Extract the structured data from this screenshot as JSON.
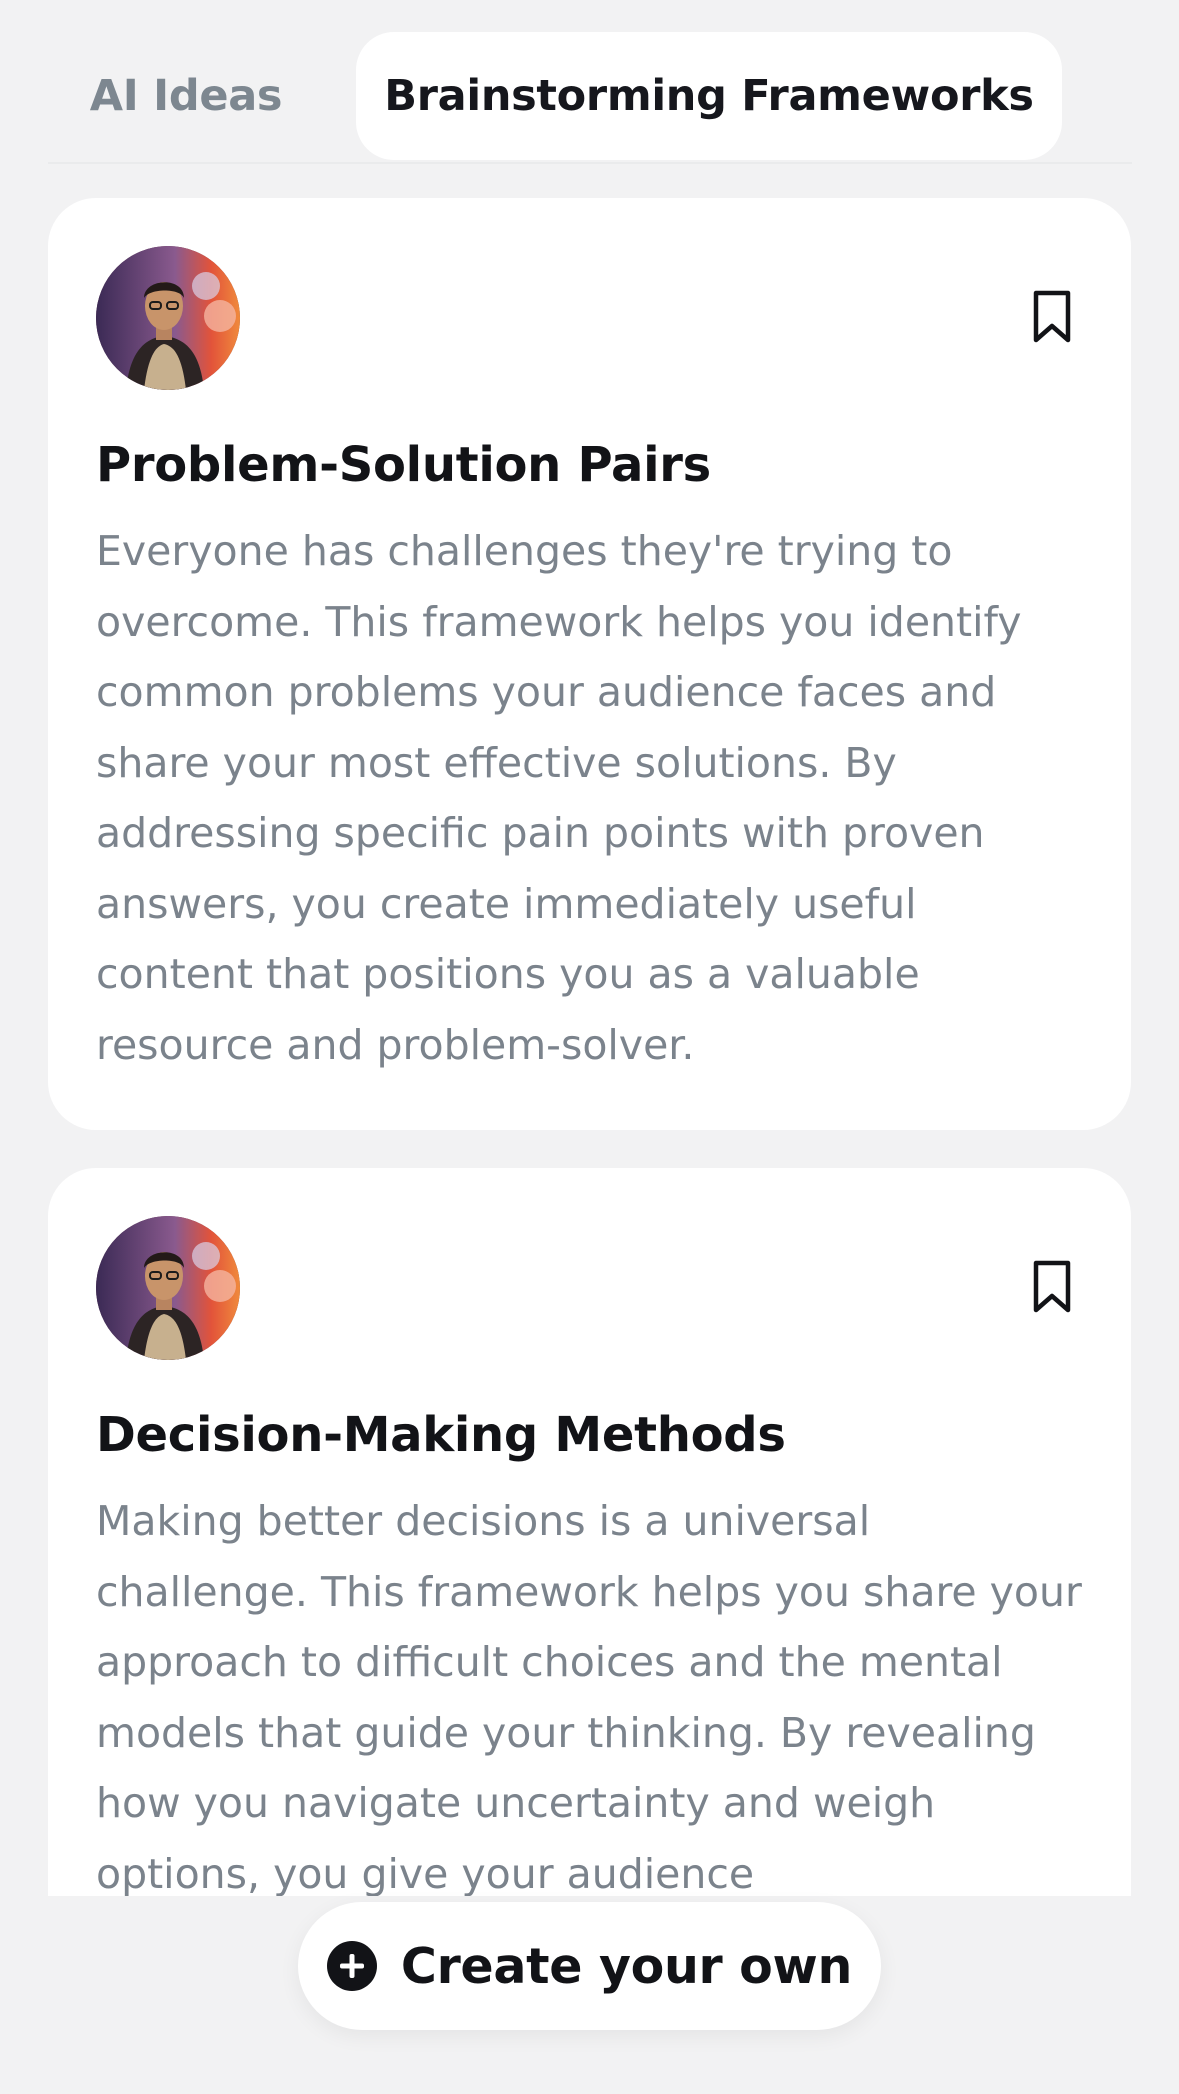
{
  "tabs": [
    {
      "label": "AI Ideas",
      "active": false
    },
    {
      "label": "Brainstorming Frameworks",
      "active": true
    }
  ],
  "cards": [
    {
      "avatar": "user-avatar-photo",
      "bookmark_icon": "bookmark-icon",
      "title": "Problem-Solution Pairs",
      "description": "Everyone has challenges they're trying to overcome. This framework helps you identify common problems your audience faces and share your most effective solutions. By addressing specific pain points with proven answers, you create immediately useful content that positions you as a valuable resource and problem-solver."
    },
    {
      "avatar": "user-avatar-photo",
      "bookmark_icon": "bookmark-icon",
      "title": "Decision-Making Methods",
      "description": "Making better decisions is a universal challenge. This framework helps you share your approach to difficult choices and the mental models that guide your thinking. By revealing how you navigate uncertainty and weigh options, you give your audience"
    }
  ],
  "create_button": {
    "icon": "plus-circle-icon",
    "label": "Create your own"
  },
  "colors": {
    "background": "#f2f2f3",
    "card": "#ffffff",
    "title_text": "#121317",
    "body_text": "#7b838c",
    "inactive_tab": "#7d8790"
  }
}
